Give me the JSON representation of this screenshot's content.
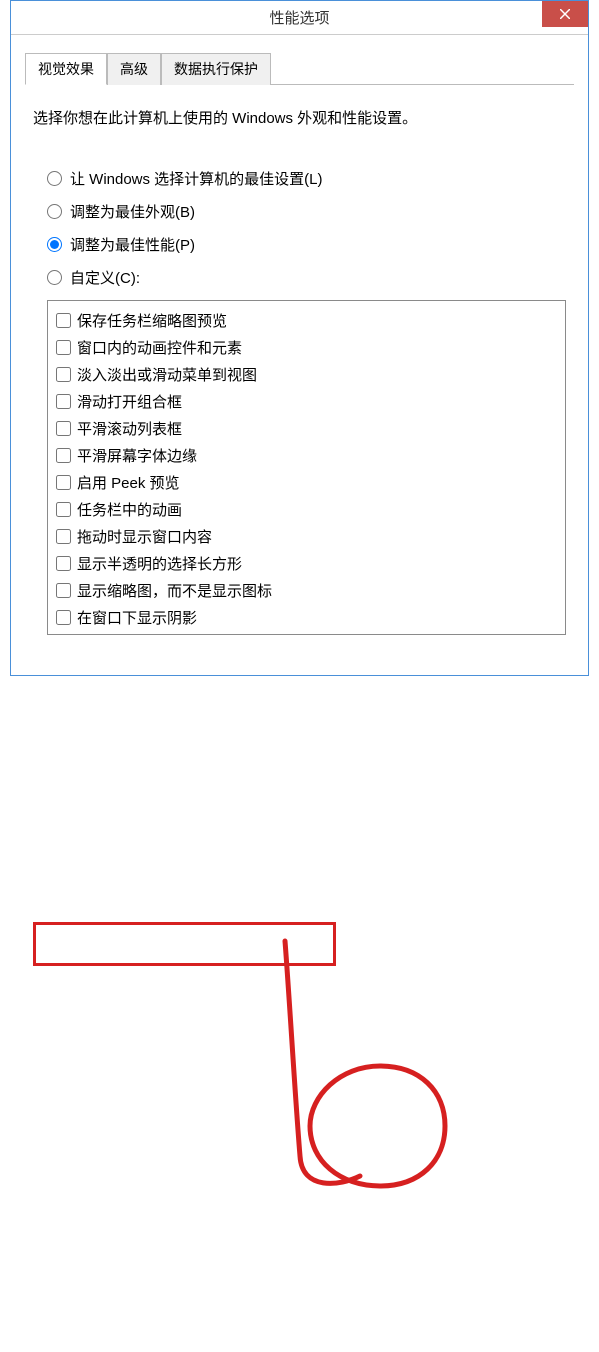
{
  "window": {
    "title": "性能选项"
  },
  "tabs": {
    "visual_effects": "视觉效果",
    "advanced": "高级",
    "dep": "数据执行保护"
  },
  "description": "选择你想在此计算机上使用的 Windows 外观和性能设置。",
  "radios": {
    "let_windows": "让 Windows 选择计算机的最佳设置(L)",
    "best_appearance": "调整为最佳外观(B)",
    "best_performance": "调整为最佳性能(P)",
    "custom": "自定义(C):"
  },
  "checkboxes": [
    "保存任务栏缩略图预览",
    "窗口内的动画控件和元素",
    "淡入淡出或滑动菜单到视图",
    "滑动打开组合框",
    "平滑滚动列表框",
    "平滑屏幕字体边缘",
    "启用 Peek 预览",
    "任务栏中的动画",
    "拖动时显示窗口内容",
    "显示半透明的选择长方形",
    "显示缩略图，而不是显示图标",
    "在窗口下显示阴影"
  ]
}
